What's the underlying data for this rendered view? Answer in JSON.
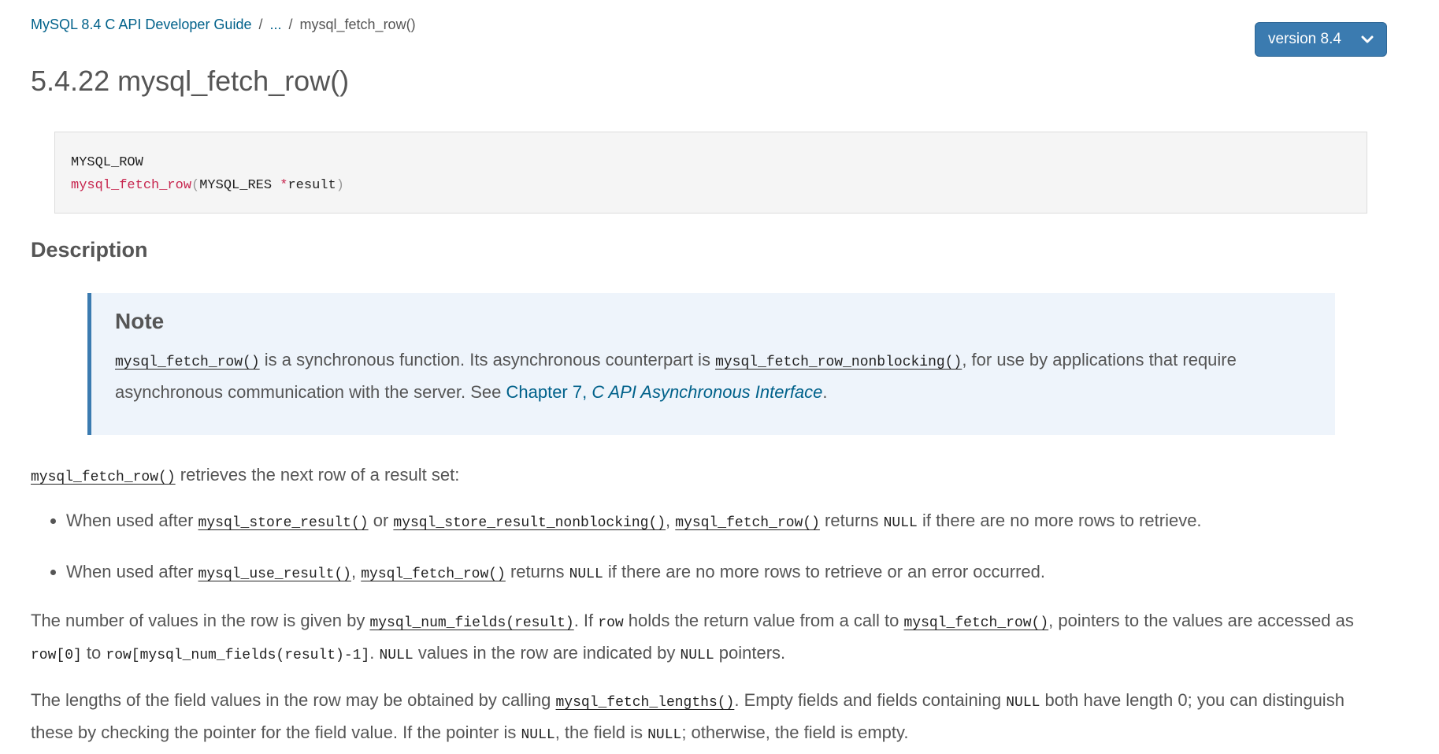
{
  "breadcrumb": {
    "root": "MySQL 8.4 C API Developer Guide",
    "separator": "/",
    "ellipsis": "...",
    "current": "mysql_fetch_row()"
  },
  "version_button": {
    "label": "version 8.4",
    "icon": "chevron-down-icon",
    "bg": "#3b7bb0"
  },
  "page_title": "5.4.22 mysql_fetch_row()",
  "synopsis": {
    "return_type": "MYSQL_ROW",
    "fn_name": "mysql_fetch_row",
    "open_paren": "(",
    "param_type": "MYSQL_RES",
    "pointer": "*",
    "param_name": "result",
    "close_paren": ")"
  },
  "description_heading": "Description",
  "note": {
    "heading": "Note",
    "fn1": "mysql_fetch_row()",
    "text1": " is a synchronous function. Its asynchronous counterpart is ",
    "fn2": "mysql_fetch_row_nonblocking()",
    "text2": ", for use by applications that require asynchronous communication with the server. See ",
    "link_chapter": "Chapter 7, ",
    "link_title": "C API Asynchronous Interface",
    "text3": "."
  },
  "para1": {
    "fn": "mysql_fetch_row()",
    "text": " retrieves the next row of a result set:"
  },
  "bullet1": {
    "t1": "When used after ",
    "fn1": "mysql_store_result()",
    "t2": " or ",
    "fn2": "mysql_store_result_nonblocking()",
    "t3": ", ",
    "fn3": "mysql_fetch_row()",
    "t4": " returns ",
    "lit1": "NULL",
    "t5": " if there are no more rows to retrieve."
  },
  "bullet2": {
    "t1": "When used after ",
    "fn1": "mysql_use_result()",
    "t2": ", ",
    "fn2": "mysql_fetch_row()",
    "t3": " returns ",
    "lit1": "NULL",
    "t4": " if there are no more rows to retrieve or an error occurred."
  },
  "para2": {
    "t1": "The number of values in the row is given by ",
    "fn1": "mysql_num_fields(result)",
    "t2": ". If ",
    "lit1": "row",
    "t3": " holds the return value from a call to ",
    "fn2": "mysql_fetch_row()",
    "t4": ", pointers to the values are accessed as ",
    "lit2": "row[0]",
    "t5": " to ",
    "lit3": "row[mysql_num_fields(result)-1]",
    "t6": ". ",
    "lit4": "NULL",
    "t7": " values in the row are indicated by ",
    "lit5": "NULL",
    "t8": " pointers."
  },
  "para3": {
    "t1": "The lengths of the field values in the row may be obtained by calling ",
    "fn1": "mysql_fetch_lengths()",
    "t2": ". Empty fields and fields containing ",
    "lit1": "NULL",
    "t3": " both have length 0; you can distinguish these by checking the pointer for the field value. If the pointer is ",
    "lit2": "NULL",
    "t4": ", the field is ",
    "lit3": "NULL",
    "t5": "; otherwise, the field is empty."
  }
}
